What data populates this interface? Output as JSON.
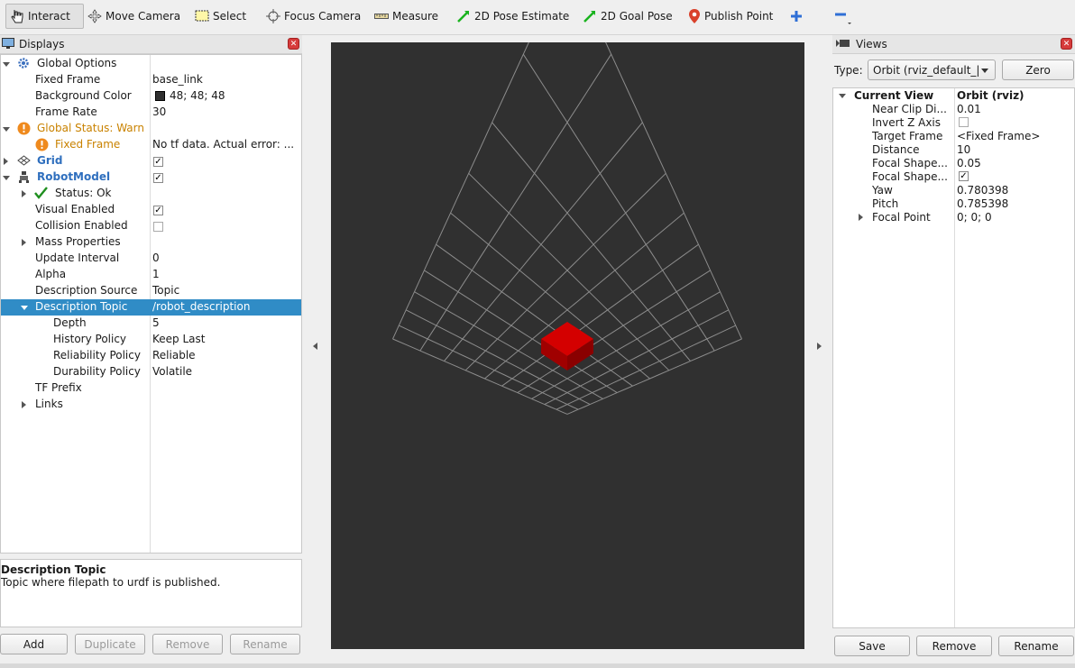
{
  "toolbar": {
    "tools": [
      {
        "label": "Interact",
        "icon": "hand-pointer-icon"
      },
      {
        "label": "Move Camera",
        "icon": "move-arrows-icon"
      },
      {
        "label": "Select",
        "icon": "select-rectangle-icon"
      },
      {
        "label": "Focus Camera",
        "icon": "focus-target-icon"
      },
      {
        "label": "Measure",
        "icon": "ruler-icon"
      },
      {
        "label": "2D Pose Estimate",
        "icon": "green-arrow-icon"
      },
      {
        "label": "2D Goal Pose",
        "icon": "green-arrow-icon"
      },
      {
        "label": "Publish Point",
        "icon": "map-pin-icon"
      }
    ],
    "add_tool_icon": "plus-icon",
    "remove_tool_icon": "minus-icon"
  },
  "displays": {
    "title": "Displays",
    "rows": {
      "global_options": {
        "label": "Global Options"
      },
      "fixed_frame": {
        "label": "Fixed Frame",
        "value": "base_link"
      },
      "background_color": {
        "label": "Background Color",
        "value": "48; 48; 48",
        "swatch": "#303030"
      },
      "frame_rate": {
        "label": "Frame Rate",
        "value": "30"
      },
      "global_status": {
        "label": "Global Status: Warn"
      },
      "fixed_frame_status": {
        "label": "Fixed Frame",
        "value": "No tf data.  Actual error: ..."
      },
      "grid": {
        "label": "Grid",
        "checked": true
      },
      "robot_model": {
        "label": "RobotModel",
        "checked": true
      },
      "status_ok": {
        "label": "Status: Ok"
      },
      "visual_enabled": {
        "label": "Visual Enabled",
        "checked": true
      },
      "collision_enabled": {
        "label": "Collision Enabled",
        "checked": false
      },
      "mass_properties": {
        "label": "Mass Properties"
      },
      "update_interval": {
        "label": "Update Interval",
        "value": "0"
      },
      "alpha": {
        "label": "Alpha",
        "value": "1"
      },
      "description_source": {
        "label": "Description Source",
        "value": "Topic"
      },
      "description_topic": {
        "label": "Description Topic",
        "value": "/robot_description"
      },
      "depth": {
        "label": "Depth",
        "value": "5"
      },
      "history_policy": {
        "label": "History Policy",
        "value": "Keep Last"
      },
      "reliability_policy": {
        "label": "Reliability Policy",
        "value": "Reliable"
      },
      "durability_policy": {
        "label": "Durability Policy",
        "value": "Volatile"
      },
      "tf_prefix": {
        "label": "TF Prefix"
      },
      "links": {
        "label": "Links"
      }
    },
    "help": {
      "title": "Description Topic",
      "text": "Topic where filepath to urdf is published."
    },
    "buttons": {
      "add": "Add",
      "duplicate": "Duplicate",
      "remove": "Remove",
      "rename": "Rename"
    }
  },
  "views": {
    "title": "Views",
    "type_label": "Type:",
    "type_value": "Orbit (rviz_default_|",
    "zero_label": "Zero",
    "rows": {
      "current_view": {
        "label": "Current View",
        "value": "Orbit (rviz)"
      },
      "near_clip": {
        "label": "Near Clip Di...",
        "value": "0.01"
      },
      "invert_z": {
        "label": "Invert Z Axis",
        "checked": false
      },
      "target_frame": {
        "label": "Target Frame",
        "value": "<Fixed Frame>"
      },
      "distance": {
        "label": "Distance",
        "value": "10"
      },
      "focal_shape_size": {
        "label": "Focal Shape...",
        "value": "0.05"
      },
      "focal_shape_fixed": {
        "label": "Focal Shape...",
        "checked": true
      },
      "yaw": {
        "label": "Yaw",
        "value": "0.780398"
      },
      "pitch": {
        "label": "Pitch",
        "value": "0.785398"
      },
      "focal_point": {
        "label": "Focal Point",
        "value": "0; 0; 0"
      }
    },
    "buttons": {
      "save": "Save",
      "remove": "Remove",
      "rename": "Rename"
    }
  },
  "viewport": {
    "background": "#303030",
    "grid_color": "#8c8c8c",
    "robot_color": "#c00000"
  }
}
